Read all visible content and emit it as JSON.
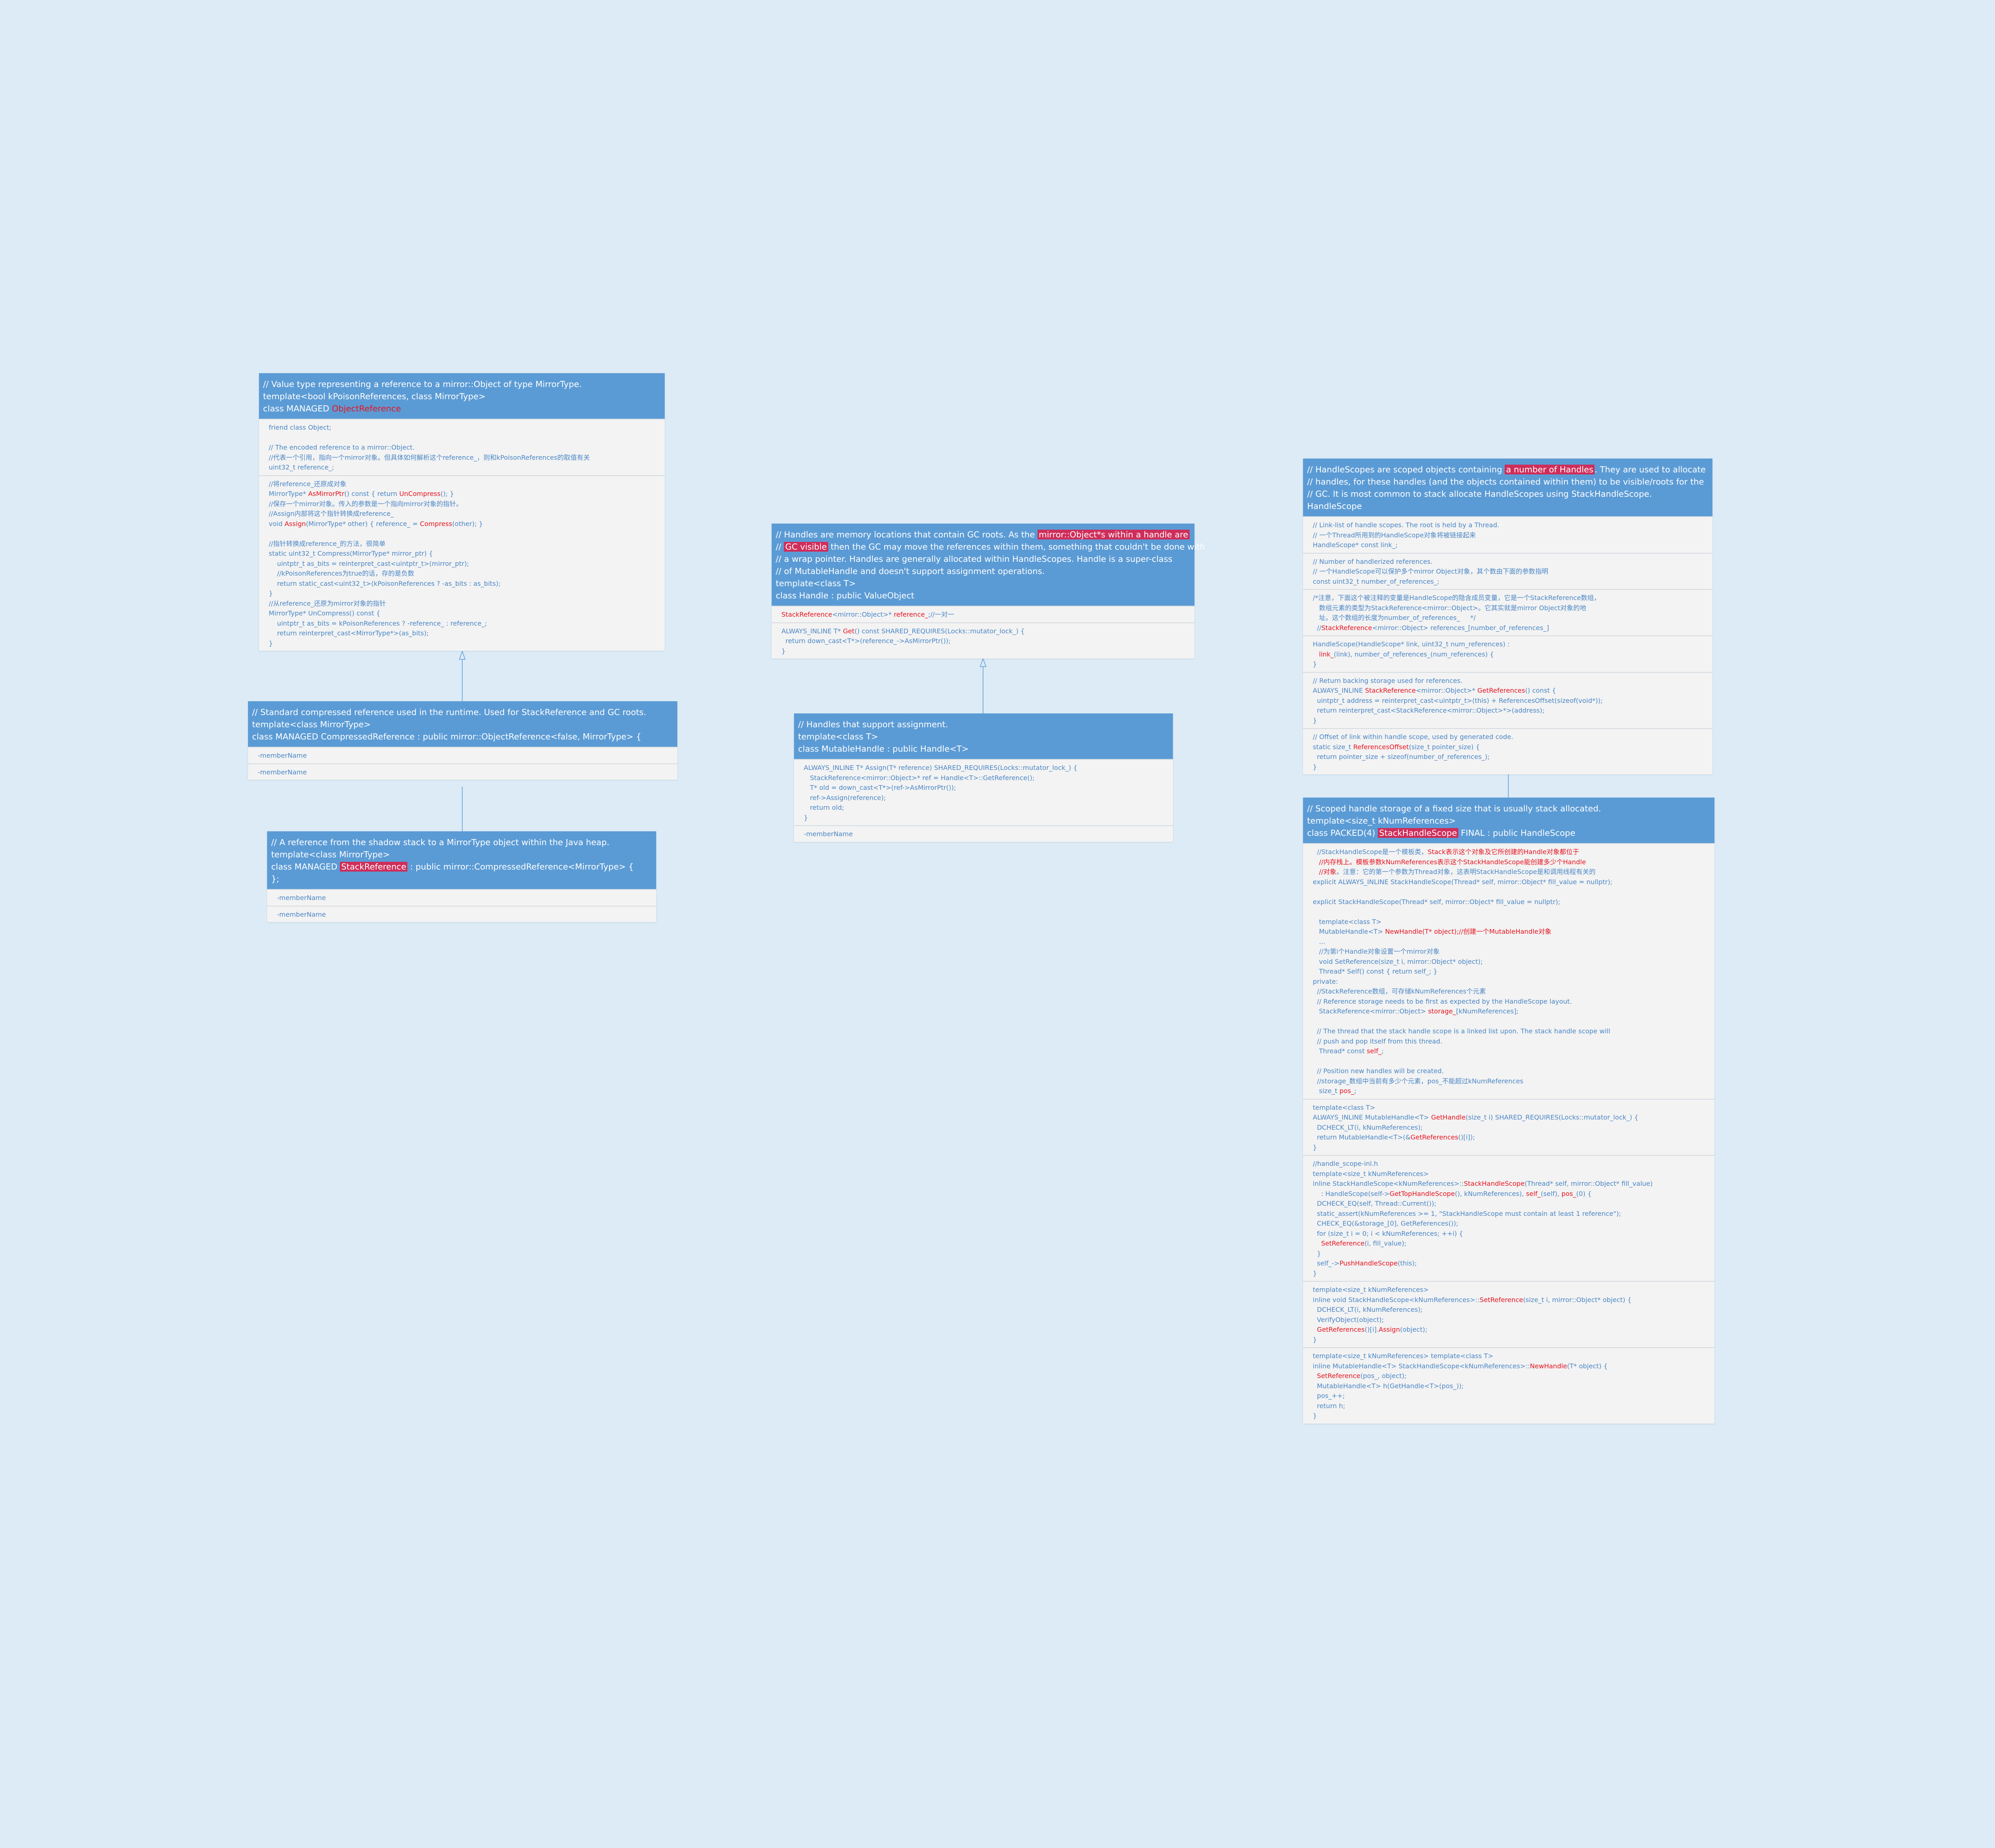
{
  "colors": {
    "background": "#dcebf6",
    "header": "#5b9bd5",
    "body": "#f3f3f3",
    "text": "#4a86c5",
    "highlight": "#e6131f",
    "highlight_bg": "#cf2d5a",
    "connector": "#7aaee0"
  },
  "classes": [
    {
      "id": "object-reference",
      "head": [
        [
          "// Value type representing a reference to a mirror::Object of type MirrorType."
        ],
        [
          "template<bool kPoisonReferences, class MirrorType>"
        ],
        [
          "class MANAGED ",
          {
            "t": "ObjectReference",
            "h": true
          }
        ]
      ],
      "sections": [
        [
          [
            "friend class Object;"
          ],
          [
            ""
          ],
          [
            "// The encoded reference to a mirror::Object."
          ],
          [
            "//代表一个引用，指向一个mirror对象。但具体如何解析这个reference_，则和kPoisonReferences的取值有关"
          ],
          [
            "uint32_t reference_;"
          ]
        ],
        [
          [
            "//将reference_还原成对象"
          ],
          [
            "MirrorType* ",
            {
              "t": "AsMirrorPtr",
              "h": true
            },
            "() const { return ",
            {
              "t": "UnCompress",
              "h": true
            },
            "(); }"
          ],
          [
            "//保存一个mirror对象。传入的参数是一个指向mirror对象的指针。"
          ],
          [
            "//Assign内部将这个指针转换成reference_"
          ],
          [
            "void ",
            {
              "t": "Assign",
              "h": true
            },
            "(MirrorType* other) { reference_ = ",
            {
              "t": "Compress",
              "h": true
            },
            "(other); }"
          ],
          [
            ""
          ],
          [
            "//指针转换成reference_的方法，很简单"
          ],
          [
            "static uint32_t Compress(MirrorType* mirror_ptr) {"
          ],
          [
            "    uintptr_t as_bits = reinterpret_cast<uintptr_t>(mirror_ptr);"
          ],
          [
            "    //kPoisonReferences为true的话，存的是负数"
          ],
          [
            "    return static_cast<uint32_t>(kPoisonReferences ? -as_bits : as_bits);"
          ],
          [
            "}"
          ],
          [
            "//从reference_还原为mirror对象的指针"
          ],
          [
            "MirrorType* UnCompress() const {"
          ],
          [
            "    uintptr_t as_bits = kPoisonReferences ? -reference_ : reference_;"
          ],
          [
            "    return reinterpret_cast<MirrorType*>(as_bits);"
          ],
          [
            "}"
          ]
        ]
      ]
    },
    {
      "id": "compressed-reference",
      "head": [
        [
          "// Standard compressed reference used in the runtime. Used for StackReference and GC roots."
        ],
        [
          "template<class MirrorType>"
        ],
        [
          "class MANAGED CompressedReference : public mirror::ObjectReference<false, MirrorType> {"
        ]
      ],
      "sections": [
        [
          [
            "-memberName"
          ]
        ],
        [
          [
            "-memberName"
          ]
        ]
      ]
    },
    {
      "id": "stack-reference",
      "head": [
        [
          "// A reference from the shadow stack to a MirrorType object within the Java heap."
        ],
        [
          "template<class MirrorType>"
        ],
        [
          "class MANAGED ",
          {
            "t": "StackReference",
            "b": true
          },
          " : public mirror::CompressedReference<MirrorType> {"
        ],
        [
          "};"
        ]
      ],
      "sections": [
        [
          [
            "-memberName"
          ]
        ],
        [
          [
            "-memberName"
          ]
        ]
      ]
    },
    {
      "id": "handle",
      "head": [
        [
          "// Handles are memory locations that contain GC roots. As the ",
          {
            "t": "mirror::Object*s within a handle are",
            "b": true
          }
        ],
        [
          "// ",
          {
            "t": "GC visible",
            "b": true
          },
          " then the GC may move the references within them, something that couldn't be done with"
        ],
        [
          "// a wrap pointer. Handles are generally allocated within HandleScopes. Handle is a super-class"
        ],
        [
          "// of MutableHandle and doesn't support assignment operations."
        ],
        [
          "template<class T>"
        ],
        [
          "class Handle : public ValueObject"
        ]
      ],
      "sections": [
        [
          [
            {
              "t": "StackReference",
              "h": true
            },
            "<mirror::Object>* ",
            {
              "t": "reference_",
              "h": true
            },
            ";//一对一"
          ]
        ],
        [
          [
            "ALWAYS_INLINE T* ",
            {
              "t": "Get",
              "h": true
            },
            "() const SHARED_REQUIRES(Locks::mutator_lock_) {"
          ],
          [
            "  return down_cast<T*>(reference_->AsMirrorPtr());"
          ],
          [
            "}"
          ]
        ]
      ]
    },
    {
      "id": "mutable-handle",
      "head": [
        [
          "// Handles that support assignment."
        ],
        [
          "template<class T>"
        ],
        [
          "class MutableHandle : public Handle<T>"
        ]
      ],
      "sections": [
        [
          [
            "ALWAYS_INLINE T* Assign(T* reference) SHARED_REQUIRES(Locks::mutator_lock_) {"
          ],
          [
            "   StackReference<mirror::Object>* ref = Handle<T>::GetReference();"
          ],
          [
            "   T* old = down_cast<T*>(ref->AsMirrorPtr());"
          ],
          [
            "   ref->Assign(reference);"
          ],
          [
            "   return old;"
          ],
          [
            "}"
          ]
        ],
        [
          [
            "-memberName"
          ]
        ]
      ]
    },
    {
      "id": "handle-scope",
      "head": [
        [
          "// HandleScopes are scoped objects containing ",
          {
            "t": "a number of Handles",
            "b": true
          },
          ". They are used to allocate"
        ],
        [
          "// handles, for these handles (and the objects contained within them) to be visible/roots for the"
        ],
        [
          "// GC. It is most common to stack allocate HandleScopes using StackHandleScope."
        ],
        [
          "HandleScope"
        ]
      ],
      "sections": [
        [
          [
            "// Link-list of handle scopes. The root is held by a Thread."
          ],
          [
            "// 一个Thread所用到的HandleScope对象将被链接起来"
          ],
          [
            "HandleScope* const link_;"
          ]
        ],
        [
          [
            "// Number of handlerized references."
          ],
          [
            "// 一个HandleScope可以保护多个mirror Object对象，其个数由下面的参数指明"
          ],
          [
            "const uint32_t number_of_references_;"
          ]
        ],
        [
          [
            "/*注意，下面这个被注释的变量是HandleScope的隐含成员变量，它是一个StackReference数组，"
          ],
          [
            "   数组元素的类型为StackReference<mirror::Object>。它其实就是mirror Object对象的地"
          ],
          [
            "   址。这个数组的长度为number_of_references_     */"
          ],
          [
            "  //",
            {
              "t": "StackReference",
              "h": true
            },
            "<mirror::Object> references_[number_of_references_]"
          ]
        ],
        [
          [
            "HandleScope(HandleScope* link, uint32_t num_references) :"
          ],
          [
            "   ",
            {
              "t": "link_",
              "h": true
            },
            "(link), number_of_references_(num_references) {"
          ],
          [
            "}"
          ]
        ],
        [
          [
            "// Return backing storage used for references."
          ],
          [
            "ALWAYS_INLINE ",
            {
              "t": "StackReference",
              "h": true
            },
            "<mirror::Object>* ",
            {
              "t": "GetReferences",
              "h": true
            },
            "() const {"
          ],
          [
            "  uintptr_t address = reinterpret_cast<uintptr_t>(this) + ReferencesOffset(sizeof(void*));"
          ],
          [
            "  return reinterpret_cast<StackReference<mirror::Object>*>(address);"
          ],
          [
            "}"
          ]
        ],
        [
          [
            "// Offset of link within handle scope, used by generated code."
          ],
          [
            "static size_t ",
            {
              "t": "ReferencesOffset",
              "h": true
            },
            "(size_t pointer_size) {"
          ],
          [
            "  return pointer_size + sizeof(number_of_references_);"
          ],
          [
            "}"
          ]
        ]
      ]
    },
    {
      "id": "stack-handle-scope",
      "head": [
        [
          "// Scoped handle storage of a fixed size that is usually stack allocated."
        ],
        [
          "template<size_t kNumReferences>"
        ],
        [
          "class PACKED(4) ",
          {
            "t": "StackHandleScope",
            "b": true
          },
          " FINAL : public HandleScope"
        ]
      ],
      "sections": [
        [
          [
            "  //StackHandleScope是一个模板类，",
            {
              "t": "Stack表示这个对象及它所创建的Handle对象都位于",
              "h": true
            }
          ],
          [
            "   ",
            {
              "t": "//内存栈上。模板参数kNumReferences表示这个StackHandleScope能创建多少个Handle",
              "h": true
            }
          ],
          [
            "   ",
            {
              "t": "//对象",
              "h": true
            },
            "。注意：它的第一个参数为Thread对象，这表明StackHandleScope是和调用线程有关的"
          ],
          [
            "explicit ALWAYS_INLINE StackHandleScope(Thread* self, mirror::Object* fill_value = nullptr);"
          ],
          [
            ""
          ],
          [
            "explicit StackHandleScope(Thread* self, mirror::Object* fill_value = nullptr);"
          ],
          [
            ""
          ],
          [
            "   template<class T>"
          ],
          [
            "   MutableHandle<T> ",
            {
              "t": "NewHandle(T* object);//创建一个MutableHandle对象",
              "h": true
            }
          ],
          [
            "   ..."
          ],
          [
            "   //为第i个Handle对象设置一个mirror对象"
          ],
          [
            "   void SetReference(size_t i, mirror::Object* object);"
          ],
          [
            "   Thread* Self() const { return self_; }"
          ],
          [
            "private:"
          ],
          [
            "  //StackReference数组，可存储kNumReferences个元素"
          ],
          [
            "  // Reference storage needs to be first as expected by the HandleScope layout."
          ],
          [
            "   StackReference<mirror::Object> ",
            {
              "t": "storage_",
              "h": true
            },
            "[kNumReferences];"
          ],
          [
            ""
          ],
          [
            "  // The thread that the stack handle scope is a linked list upon. The stack handle scope will"
          ],
          [
            "  // push and pop itself from this thread."
          ],
          [
            "   Thread* const ",
            {
              "t": "self_",
              "h": true
            },
            ";"
          ],
          [
            ""
          ],
          [
            "  // Position new handles will be created."
          ],
          [
            "  //storage_数组中当前有多少个元素，pos_不能超过kNumReferences"
          ],
          [
            "   size_t ",
            {
              "t": "pos_",
              "h": true
            },
            ";"
          ]
        ],
        [
          [
            "template<class T>"
          ],
          [
            "ALWAYS_INLINE MutableHandle<T> ",
            {
              "t": "GetHandle",
              "h": true
            },
            "(size_t i) SHARED_REQUIRES(Locks::mutator_lock_) {"
          ],
          [
            "  DCHECK_LT(i, kNumReferences);"
          ],
          [
            "  return MutableHandle<T>(&",
            {
              "t": "GetReferences",
              "h": true
            },
            "()[i]);"
          ],
          [
            "}"
          ]
        ],
        [
          [
            "//handle_scope-inl.h"
          ],
          [
            "template<size_t kNumReferences>"
          ],
          [
            "inline StackHandleScope<kNumReferences>::",
            {
              "t": "StackHandleScope",
              "h": true
            },
            "(Thread* self, mirror::Object* fill_value)"
          ],
          [
            "    : HandleScope(self->",
            {
              "t": "GetTopHandleScope",
              "h": true
            },
            "(), kNumReferences), ",
            {
              "t": "self_",
              "h": true
            },
            "(self), ",
            {
              "t": "pos_",
              "h": true
            },
            "(0) {"
          ],
          [
            "  DCHECK_EQ(self, Thread::Current());"
          ],
          [
            "  static_assert(kNumReferences >= 1, \"StackHandleScope must contain at least 1 reference\");"
          ],
          [
            "  CHECK_EQ(&storage_[0], GetReferences());"
          ],
          [
            "  for (size_t i = 0; i < kNumReferences; ++i) {"
          ],
          [
            "    ",
            {
              "t": "SetReference",
              "h": true
            },
            "(i, fill_value);"
          ],
          [
            "  }"
          ],
          [
            "  self_->",
            {
              "t": "PushHandleScope",
              "h": true
            },
            "(this);"
          ],
          [
            "}"
          ]
        ],
        [
          [
            "template<size_t kNumReferences>"
          ],
          [
            "inline void StackHandleScope<kNumReferences>::",
            {
              "t": "SetReference",
              "h": true
            },
            "(size_t i, mirror::Object* object) {"
          ],
          [
            "  DCHECK_LT(i, kNumReferences);"
          ],
          [
            "  VerifyObject(object);"
          ],
          [
            "  ",
            {
              "t": "GetReferences",
              "h": true
            },
            "()[i].",
            {
              "t": "Assign",
              "h": true
            },
            "(object);"
          ],
          [
            "}"
          ]
        ],
        [
          [
            "template<size_t kNumReferences> template<class T>"
          ],
          [
            "inline MutableHandle<T> StackHandleScope<kNumReferences>::",
            {
              "t": "NewHandle",
              "h": true
            },
            "(T* object) {"
          ],
          [
            "  ",
            {
              "t": "SetReference",
              "h": true
            },
            "(pos_, object);"
          ],
          [
            "  MutableHandle<T> h(GetHandle<T>(pos_));"
          ],
          [
            "  pos_++;"
          ],
          [
            "  return h;"
          ],
          [
            "}"
          ]
        ]
      ]
    }
  ]
}
